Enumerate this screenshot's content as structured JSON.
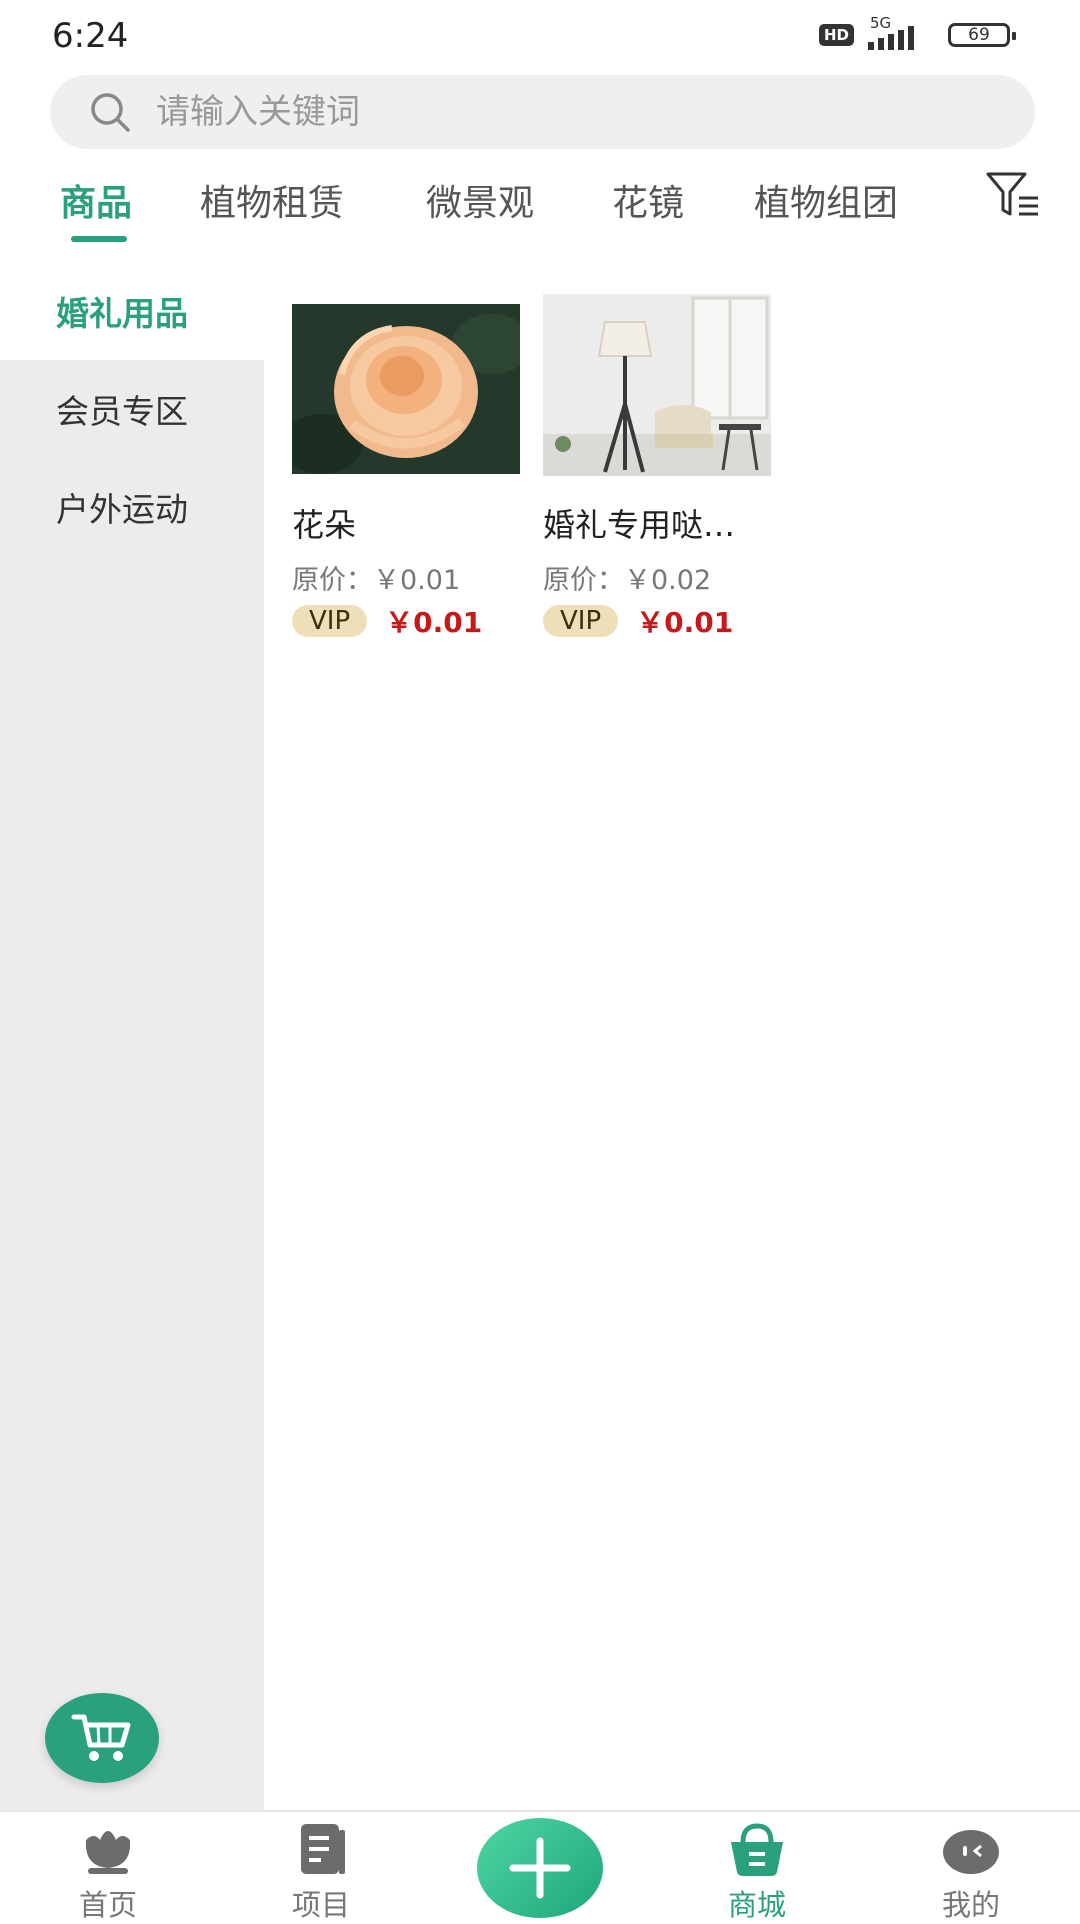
{
  "status_bar": {
    "time": "6:24",
    "hd": "HD",
    "network": "5G",
    "battery": "69"
  },
  "search": {
    "placeholder": "请输入关键词"
  },
  "tabs": [
    {
      "label": "商品",
      "active": true
    },
    {
      "label": "植物租赁",
      "active": false
    },
    {
      "label": "微景观",
      "active": false
    },
    {
      "label": "花镜",
      "active": false
    },
    {
      "label": "植物组团",
      "active": false
    }
  ],
  "sidebar": {
    "items": [
      {
        "label": "婚礼用品",
        "active": true
      },
      {
        "label": "会员专区",
        "active": false
      },
      {
        "label": "户外运动",
        "active": false
      }
    ]
  },
  "products": [
    {
      "name": "花朵",
      "original_price": "原价：￥0.01",
      "vip_label": "VIP",
      "vip_price": "￥0.01"
    },
    {
      "name": "婚礼专用哒…",
      "original_price": "原价：￥0.02",
      "vip_label": "VIP",
      "vip_price": "￥0.01"
    }
  ],
  "bottom_nav": [
    {
      "label": "首页",
      "icon": "home-flower-icon",
      "active": false
    },
    {
      "label": "项目",
      "icon": "project-doc-icon",
      "active": false
    },
    {
      "label": "",
      "icon": "plus-icon",
      "active": false
    },
    {
      "label": "商城",
      "icon": "shop-basket-icon",
      "active": true
    },
    {
      "label": "我的",
      "icon": "profile-face-icon",
      "active": false
    }
  ],
  "colors": {
    "accent": "#2aa07e",
    "price_red": "#c81919",
    "vip_badge": "#ede0b9",
    "sidebar_bg": "#ececec"
  }
}
